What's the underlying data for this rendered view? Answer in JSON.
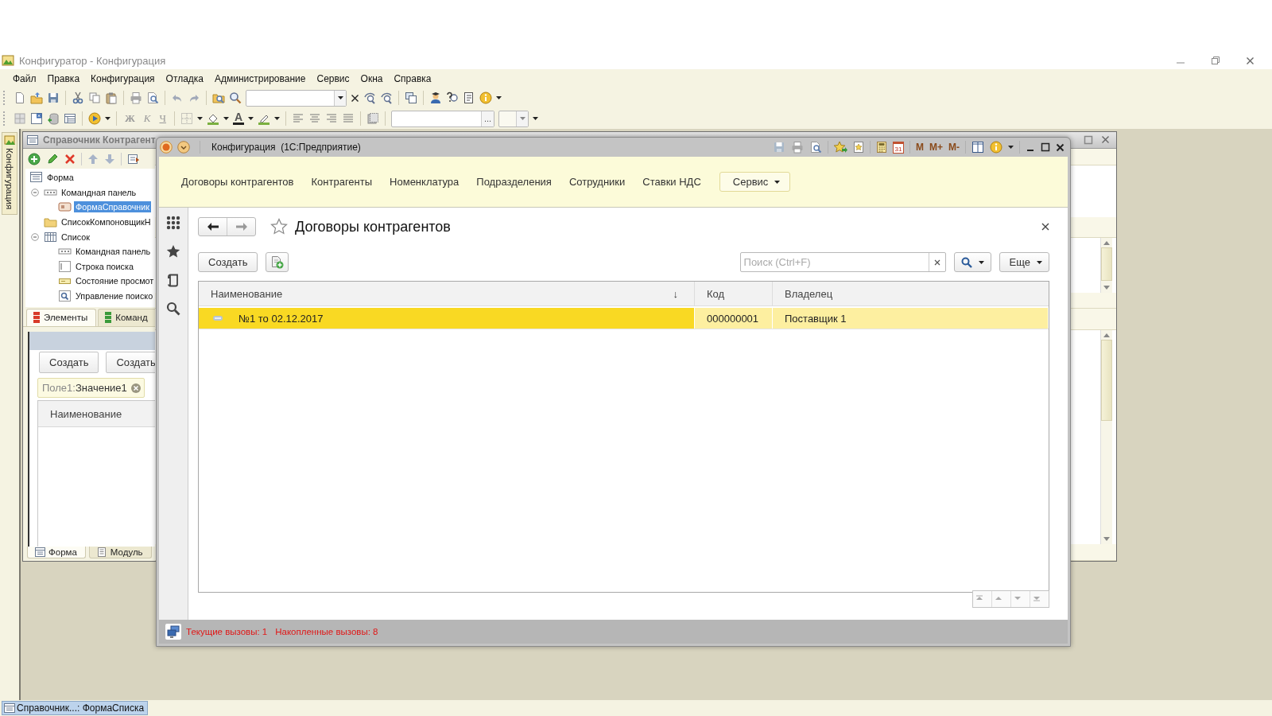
{
  "window": {
    "title": "Конфигуратор - Конфигурация"
  },
  "menu": [
    "Файл",
    "Правка",
    "Конфигурация",
    "Отладка",
    "Администрирование",
    "Сервис",
    "Окна",
    "Справка"
  ],
  "toolbar": {
    "format_buttons": [
      "Ж",
      "К",
      "Ч"
    ],
    "font_color_button": "A",
    "picker_button": "..."
  },
  "side_panel": {
    "tab": "Конфигурация"
  },
  "form_editor": {
    "title": "Справочник Контрагент",
    "tree": [
      {
        "label": "Форма",
        "kind": "form",
        "selected": false,
        "children": [
          {
            "label": "Командная панель",
            "kind": "panel",
            "selected": false,
            "expanded": true,
            "children": [
              {
                "label": "ФормаСправочник",
                "kind": "button",
                "selected": true
              }
            ]
          },
          {
            "label": "СписокКомпоновщикН",
            "kind": "folder",
            "selected": false
          },
          {
            "label": "Список",
            "kind": "table",
            "selected": false,
            "expanded": true,
            "children": [
              {
                "label": "Командная панель",
                "kind": "panel",
                "selected": false
              },
              {
                "label": "Строка поиска",
                "kind": "field",
                "selected": false
              },
              {
                "label": "Состояние просмот",
                "kind": "status",
                "selected": false
              },
              {
                "label": "Управление поиско",
                "kind": "search",
                "selected": false
              }
            ]
          }
        ]
      }
    ],
    "tabs": [
      {
        "label": "Элементы",
        "selected": true,
        "color": "#d83a2a"
      },
      {
        "label": "Команд",
        "selected": false,
        "color": "#3a9a3a"
      }
    ],
    "preview": {
      "buttons": [
        "Создать",
        "Создать"
      ],
      "filter": {
        "field": "Поле1:",
        "value": "Значение1"
      },
      "column": "Наименование"
    },
    "bottom_tabs": [
      {
        "label": "Форма",
        "selected": true
      },
      {
        "label": "Модуль",
        "selected": false
      }
    ]
  },
  "enterprise_window": {
    "title": "Конфигурация  (1С:Предприятие)",
    "calendar_day": "31",
    "memory_buttons": [
      "M",
      "M+",
      "M-"
    ],
    "sections": [
      "Договоры контрагентов",
      "Контрагенты",
      "Номенклатура",
      "Подразделения",
      "Сотрудники",
      "Ставки НДС"
    ],
    "service_menu": "Сервис",
    "form": {
      "title": "Договоры контрагентов",
      "create": "Создать",
      "search_placeholder": "Поиск (Ctrl+F)",
      "more": "Еще",
      "columns": [
        {
          "label": "Наименование",
          "sort_mark": "↓"
        },
        {
          "label": "Код"
        },
        {
          "label": "Владелец"
        }
      ],
      "rows": [
        {
          "selected": true,
          "cells": [
            {
              "text": "№1 то 02.12.2017",
              "current": true
            },
            {
              "text": "000000001",
              "current": false
            },
            {
              "text": "Поставщик 1",
              "current": false
            }
          ]
        }
      ]
    },
    "status": [
      "Текущие вызовы: 1",
      "Накопленные вызовы: 8"
    ]
  },
  "taskbar": [
    {
      "label": "Справочник...: ФормаСписка",
      "selected": true
    }
  ]
}
